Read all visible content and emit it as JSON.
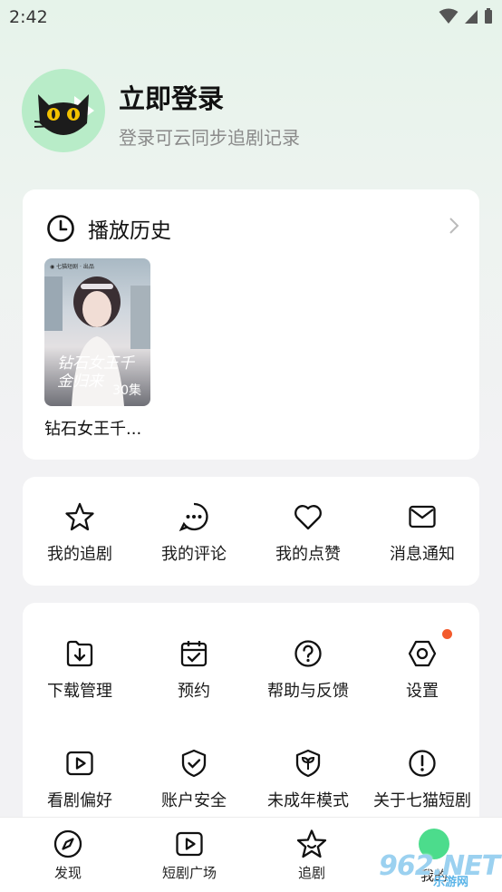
{
  "status": {
    "time": "2:42"
  },
  "profile": {
    "title": "立即登录",
    "subtitle": "登录可云同步追剧记录"
  },
  "history": {
    "title": "播放历史",
    "item": {
      "name": "钻石女王千...",
      "poster_title": "钻石女王千金归来",
      "episodes": "30集"
    }
  },
  "quick_actions": [
    {
      "label": "我的追剧",
      "icon": "star-icon"
    },
    {
      "label": "我的评论",
      "icon": "chat-bubble-icon"
    },
    {
      "label": "我的点赞",
      "icon": "heart-icon"
    },
    {
      "label": "消息通知",
      "icon": "mail-icon"
    }
  ],
  "services": [
    {
      "label": "下载管理",
      "icon": "download-folder-icon"
    },
    {
      "label": "预约",
      "icon": "calendar-check-icon"
    },
    {
      "label": "帮助与反馈",
      "icon": "help-icon"
    },
    {
      "label": "设置",
      "icon": "gear-hex-icon",
      "badge": true
    },
    {
      "label": "看剧偏好",
      "icon": "play-box-icon"
    },
    {
      "label": "账户安全",
      "icon": "shield-check-icon"
    },
    {
      "label": "未成年模式",
      "icon": "youth-shield-icon"
    },
    {
      "label": "关于七猫短剧",
      "icon": "info-icon"
    }
  ],
  "bottom_nav": [
    {
      "label": "发现",
      "icon": "compass-icon"
    },
    {
      "label": "短剧广场",
      "icon": "play-box-icon"
    },
    {
      "label": "追剧",
      "icon": "star-face-icon"
    },
    {
      "label": "我的",
      "icon": "profile-icon"
    }
  ],
  "watermark": {
    "text": "962.NET",
    "sub": "乐游网"
  },
  "colors": {
    "accent_green": "#4cdc8c",
    "badge": "#f35a2c",
    "avatar_bg": "#b8ecc8"
  }
}
